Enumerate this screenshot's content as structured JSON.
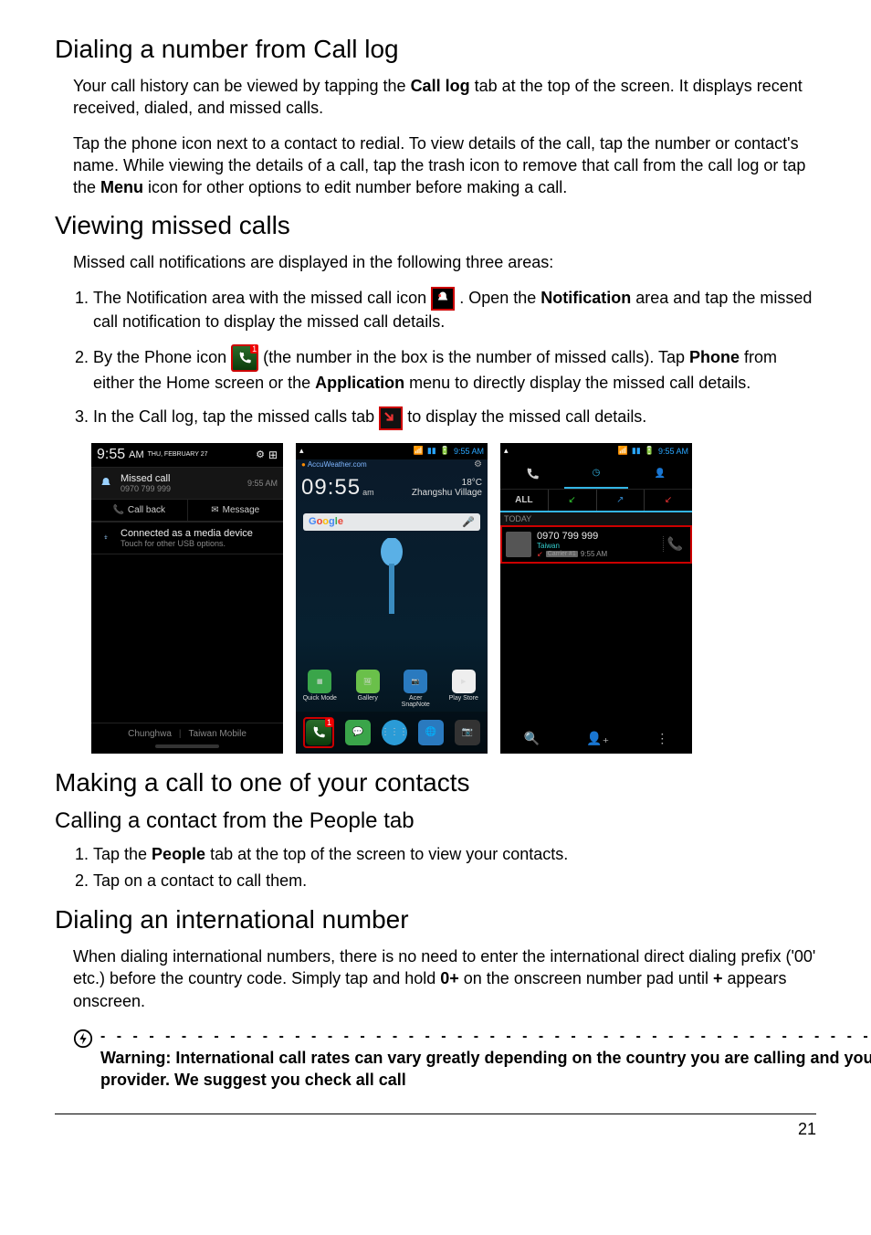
{
  "headings": {
    "h_dial_log": "Dialing a number from Call log",
    "h_missed": "Viewing missed calls",
    "h_make_call": "Making a call to one of your contacts",
    "h_call_people": "Calling a contact from the People tab",
    "h_intl": "Dialing an international number"
  },
  "paragraphs": {
    "p1a": "Your call history can be viewed by tapping the ",
    "p1b": "Call log",
    "p1c": " tab at the top of the screen. It displays recent received, dialed, and missed calls.",
    "p2a": "Tap the phone icon next to a contact to redial. To view details of the call, tap the number or contact's name. While viewing the details of a call, tap the trash icon to remove that call from the call log or tap the ",
    "p2b": "Menu",
    "p2c": " icon for other options to edit number before making a call.",
    "p3": "Missed call notifications are displayed in the following three areas:",
    "p4a": "When dialing international numbers, there is no need to enter the international direct dialing prefix ('00' etc.) before the country code. Simply tap and hold ",
    "p4b": "0+",
    "p4c": " on the onscreen number pad until ",
    "p4d": "+",
    "p4e": " appears onscreen."
  },
  "missed_list": {
    "i1a": "The Notification area with the missed call icon ",
    "i1b": ". Open the ",
    "i1c": "Notification",
    "i1d": " area and tap the missed call notification to display the missed call details.",
    "i2a": "By the Phone icon ",
    "i2b": " (the number in the box is the number of missed calls). Tap ",
    "i2c": "Phone",
    "i2d": " from either the Home screen or the ",
    "i2e": "Application",
    "i2f": " menu to directly display the missed call details.",
    "i3a": "In the Call log, tap the missed calls tab ",
    "i3b": " to display the missed call details."
  },
  "people_list": {
    "i1a": "Tap the ",
    "i1b": "People",
    "i1c": " tab at the top of the screen to view your contacts.",
    "i2": "Tap on a contact to call them."
  },
  "shot1": {
    "clock": "9:55",
    "ampm": "AM",
    "date": "THU, FEBRUARY 27",
    "miss_title": "Missed call",
    "miss_num": "0970 799 999",
    "miss_time": "9:55 AM",
    "callback": "Call back",
    "message": "Message",
    "usb_t": "Connected as a media device",
    "usb_s": "Touch for other USB options.",
    "carrier1": "Chunghwa",
    "carrier2": "Taiwan Mobile"
  },
  "shot2": {
    "status_time": "9:55 AM",
    "accu": "AccuWeather.com",
    "clock": "09:55",
    "ampm": "am",
    "temp": "18°C",
    "loc": "Zhangshu Village",
    "apps": [
      "Quick Mode",
      "Gallery",
      "Acer SnapNote",
      "Play Store"
    ]
  },
  "shot3": {
    "status_time": "9:55 AM",
    "tab_all": "ALL",
    "today": "TODAY",
    "num": "0970 799 999",
    "loc": "Taiwan",
    "carrier": "Carrier #1",
    "time": "9:55 AM"
  },
  "warning": "Warning: International call rates can vary greatly depending on the country you are calling and your network provider. We suggest you check all call",
  "page_number": "21"
}
